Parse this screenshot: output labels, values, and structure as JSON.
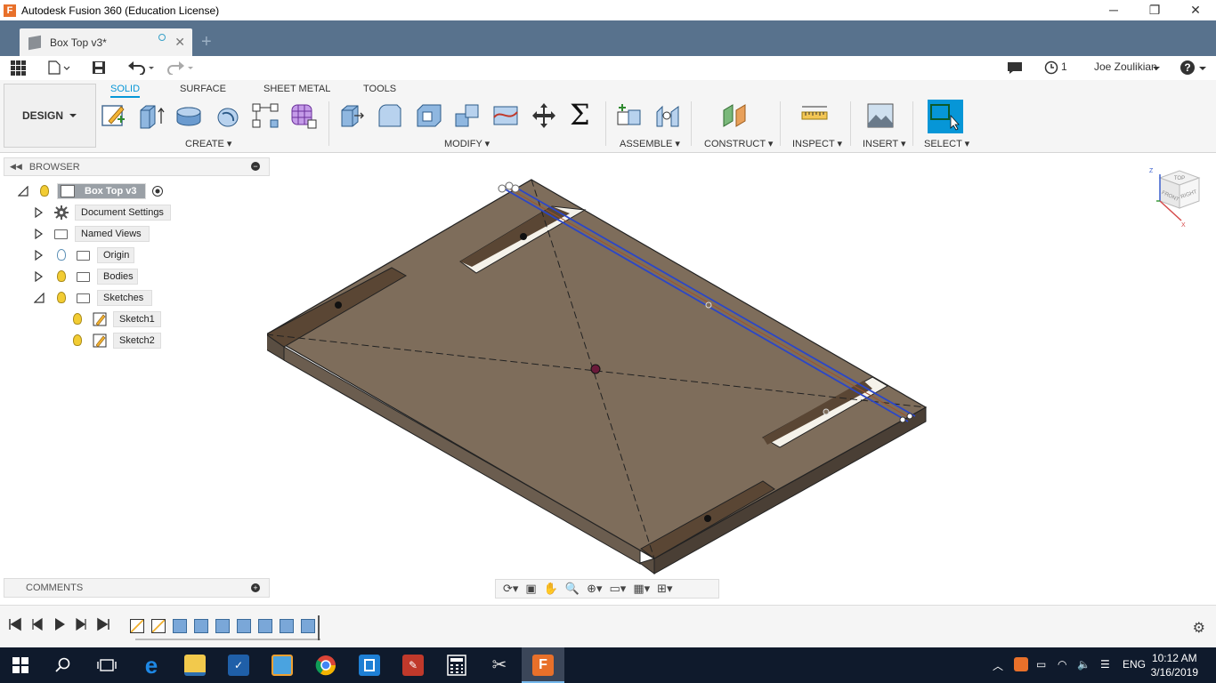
{
  "window": {
    "title": "Autodesk Fusion 360 (Education License)",
    "minimize": "─",
    "maximize": "❐",
    "close": "✕"
  },
  "document_tab": {
    "label": "Box Top v3*",
    "close": "✕",
    "new_tab": "+"
  },
  "qat": {
    "jobs_count": "1",
    "user": "Joe Zoulikian",
    "help": "?"
  },
  "workspace": {
    "label": "DESIGN"
  },
  "ribbon": {
    "tabs": [
      "SOLID",
      "SURFACE",
      "SHEET METAL",
      "TOOLS"
    ],
    "groups": {
      "create": "CREATE",
      "modify": "MODIFY",
      "assemble": "ASSEMBLE",
      "construct": "CONSTRUCT",
      "inspect": "INSPECT",
      "insert": "INSERT",
      "select": "SELECT"
    },
    "sigma": "Σ"
  },
  "browser": {
    "title": "BROWSER",
    "root": "Box Top v3",
    "items": [
      {
        "label": "Document Settings"
      },
      {
        "label": "Named Views"
      },
      {
        "label": "Origin"
      },
      {
        "label": "Bodies"
      },
      {
        "label": "Sketches"
      },
      {
        "label": "Sketch1"
      },
      {
        "label": "Sketch2"
      }
    ]
  },
  "comments": {
    "title": "COMMENTS"
  },
  "viewcube": {
    "top": "TOP",
    "front": "FRONT",
    "right": "RIGHT",
    "z": "Z",
    "x": "X"
  },
  "taskbar": {
    "language": "ENG",
    "time": "10:12 AM",
    "date": "3/16/2019"
  },
  "colors": {
    "accent": "#0696d7",
    "tab_bar": "#58728d",
    "taskbar": "#0f1a2c",
    "wood": "#7e6d5b"
  }
}
